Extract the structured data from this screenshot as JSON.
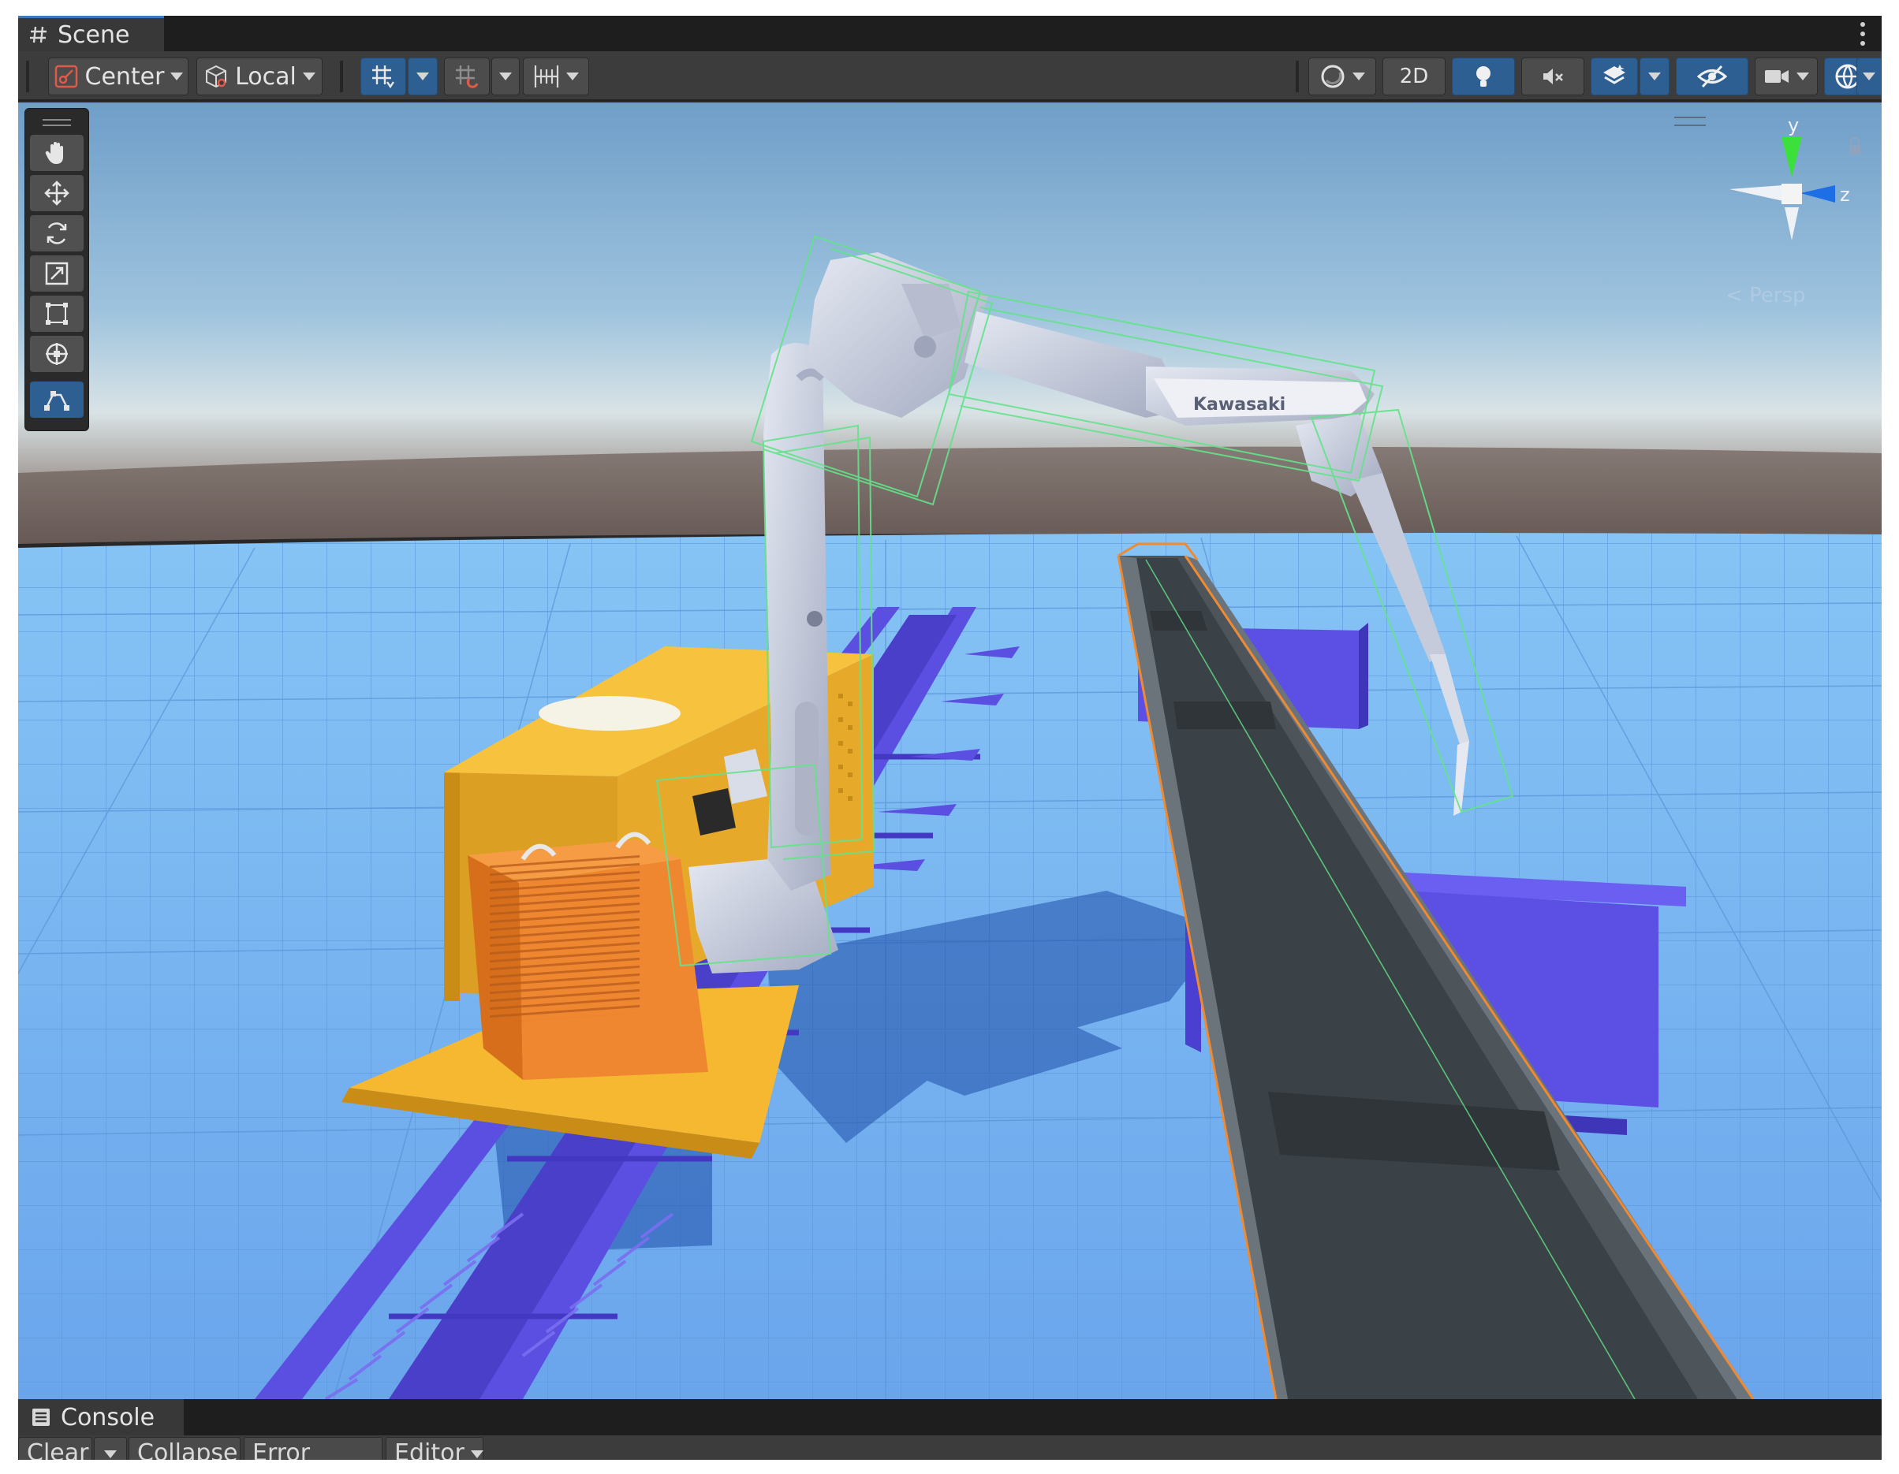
{
  "scene_tab": {
    "label": "Scene",
    "icon": "hash-icon"
  },
  "toolbar": {
    "pivot_label": "Center",
    "space_label": "Local",
    "two_d_label": "2D"
  },
  "viewport": {
    "robot_brand": "Kawasaki",
    "gizmo": {
      "y_label": "y",
      "z_label": "z",
      "projection_label": "Persp"
    },
    "colors": {
      "sky": "#6f9ec8",
      "horizon": "#72625a",
      "ground": "#6ba8ec",
      "selection": "#63e38a",
      "rail": "#5a4fe0",
      "platform": "#f5b830",
      "robot": "#c9cfe0"
    }
  },
  "console": {
    "tab_label": "Console",
    "clear_label": "Clear",
    "collapse_label": "Collapse",
    "error_pause_label": "Error Pause",
    "editor_label": "Editor"
  }
}
